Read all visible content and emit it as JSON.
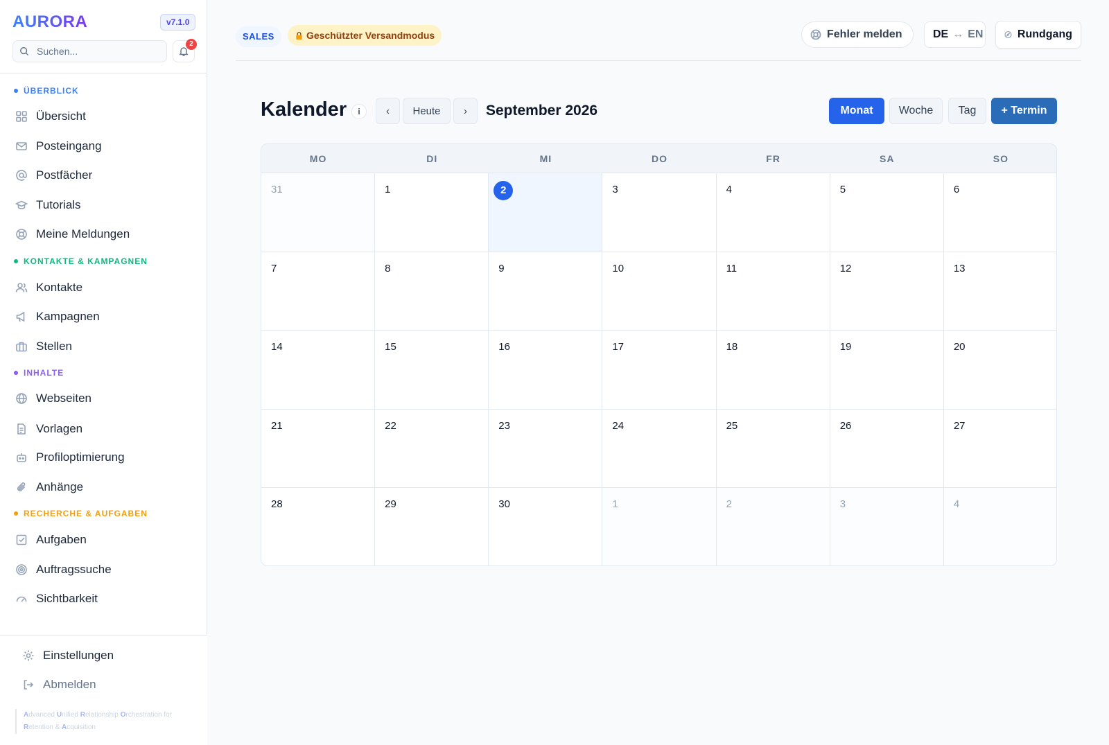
{
  "app": {
    "logo": "AURORA",
    "version": "v7.1.0"
  },
  "search": {
    "placeholder": "Suchen..."
  },
  "notifications": {
    "count": "2"
  },
  "nav": {
    "sections": [
      {
        "title": "ÜBERBLICK",
        "color": "#3b82f6",
        "items": [
          {
            "label": "Übersicht",
            "icon": "grid-icon"
          },
          {
            "label": "Posteingang",
            "icon": "mail-icon"
          },
          {
            "label": "Postfächer",
            "icon": "at-icon"
          },
          {
            "label": "Tutorials",
            "icon": "graduation-cap-icon"
          },
          {
            "label": "Meine Meldungen",
            "icon": "lifebuoy-icon"
          }
        ]
      },
      {
        "title": "KONTAKTE & KAMPAGNEN",
        "color": "#10b981",
        "items": [
          {
            "label": "Kontakte",
            "icon": "users-icon"
          },
          {
            "label": "Kampagnen",
            "icon": "megaphone-icon"
          },
          {
            "label": "Stellen",
            "icon": "briefcase-icon"
          }
        ]
      },
      {
        "title": "INHALTE",
        "color": "#8b5cf6",
        "items": [
          {
            "label": "Webseiten",
            "icon": "globe-icon"
          },
          {
            "label": "Vorlagen",
            "icon": "document-icon"
          },
          {
            "label": "Profiloptimierung",
            "icon": "robot-icon"
          },
          {
            "label": "Anhänge",
            "icon": "paperclip-icon"
          }
        ]
      },
      {
        "title": "RECHERCHE & AUFGABEN",
        "color": "#f59e0b",
        "items": [
          {
            "label": "Aufgaben",
            "icon": "checkbox-icon"
          },
          {
            "label": "Auftragssuche",
            "icon": "target-icon"
          },
          {
            "label": "Sichtbarkeit",
            "icon": "gauge-icon"
          }
        ]
      }
    ]
  },
  "footer": {
    "settings": "Einstellungen",
    "logout": "Abmelden",
    "tagline": [
      {
        "initial": "A",
        "rest": "dvanced "
      },
      {
        "initial": "U",
        "rest": "nified "
      },
      {
        "initial": "R",
        "rest": "elationship "
      },
      {
        "initial": "O",
        "rest": "rchestration for "
      },
      {
        "initial": "R",
        "rest": "etention & "
      },
      {
        "initial": "A",
        "rest": "cquisition"
      }
    ]
  },
  "topbar": {
    "sales": "SALES",
    "protected_mode": "Geschützter Versandmodus",
    "report_bug": "Fehler melden",
    "lang_de": "DE",
    "lang_sep": "↔",
    "lang_en": "EN",
    "tour": "Rundgang"
  },
  "calendar": {
    "title": "Kalender",
    "info": "i",
    "prev": "‹",
    "today": "Heute",
    "next": "›",
    "month_label": "September 2026",
    "views": {
      "month": "Monat",
      "week": "Woche",
      "day": "Tag"
    },
    "add_event": "+ Termin",
    "weekdays": [
      "MO",
      "DI",
      "MI",
      "DO",
      "FR",
      "SA",
      "SO"
    ],
    "weeks": [
      [
        {
          "d": "31",
          "out": true
        },
        {
          "d": "1"
        },
        {
          "d": "2",
          "today": true
        },
        {
          "d": "3"
        },
        {
          "d": "4"
        },
        {
          "d": "5"
        },
        {
          "d": "6"
        }
      ],
      [
        {
          "d": "7"
        },
        {
          "d": "8"
        },
        {
          "d": "9"
        },
        {
          "d": "10"
        },
        {
          "d": "11"
        },
        {
          "d": "12"
        },
        {
          "d": "13"
        }
      ],
      [
        {
          "d": "14"
        },
        {
          "d": "15"
        },
        {
          "d": "16"
        },
        {
          "d": "17"
        },
        {
          "d": "18"
        },
        {
          "d": "19"
        },
        {
          "d": "20"
        }
      ],
      [
        {
          "d": "21"
        },
        {
          "d": "22"
        },
        {
          "d": "23"
        },
        {
          "d": "24"
        },
        {
          "d": "25"
        },
        {
          "d": "26"
        },
        {
          "d": "27"
        }
      ],
      [
        {
          "d": "28"
        },
        {
          "d": "29"
        },
        {
          "d": "30"
        },
        {
          "d": "1",
          "out": true
        },
        {
          "d": "2",
          "out": true
        },
        {
          "d": "3",
          "out": true
        },
        {
          "d": "4",
          "out": true
        }
      ]
    ]
  }
}
